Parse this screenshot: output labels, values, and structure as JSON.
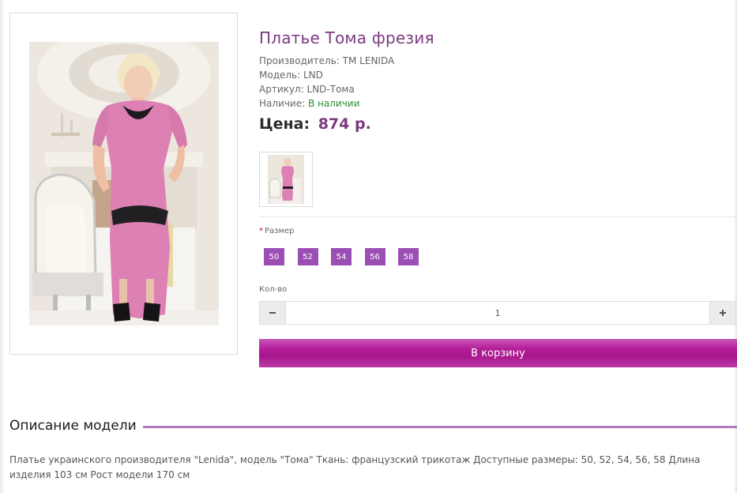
{
  "product": {
    "title": "Платье Тома фрезия",
    "manufacturer_label": "Производитель:",
    "manufacturer": "TM LENIDA",
    "model_label": "Модель:",
    "model": "LND",
    "sku_label": "Артикул:",
    "sku": "LND-Тома",
    "availability_label": "Наличие:",
    "availability": "В наличии",
    "price_label": "Цена:",
    "price": "874 р."
  },
  "options": {
    "size_required_mark": "*",
    "size_label": "Размер",
    "sizes": [
      "50",
      "52",
      "54",
      "56",
      "58"
    ],
    "qty_label": "Кол-во",
    "qty_value": "1"
  },
  "cart": {
    "button_label": "В корзину"
  },
  "description": {
    "heading": "Описание модели",
    "text": "Платье украинского производителя \"Lenida\", модель \"Тома\" Ткань: французский трикотаж Доступные размеры: 50, 52, 54, 56, 58 Длина изделия 103 см Рост модели 170 см"
  },
  "colors": {
    "accent": "#7b3a80",
    "size_button": "#9b4fb4",
    "cart_button": "#b41d98",
    "in_stock": "#2e8b3a"
  },
  "icons": {
    "minus": "minus-icon",
    "plus": "plus-icon"
  }
}
